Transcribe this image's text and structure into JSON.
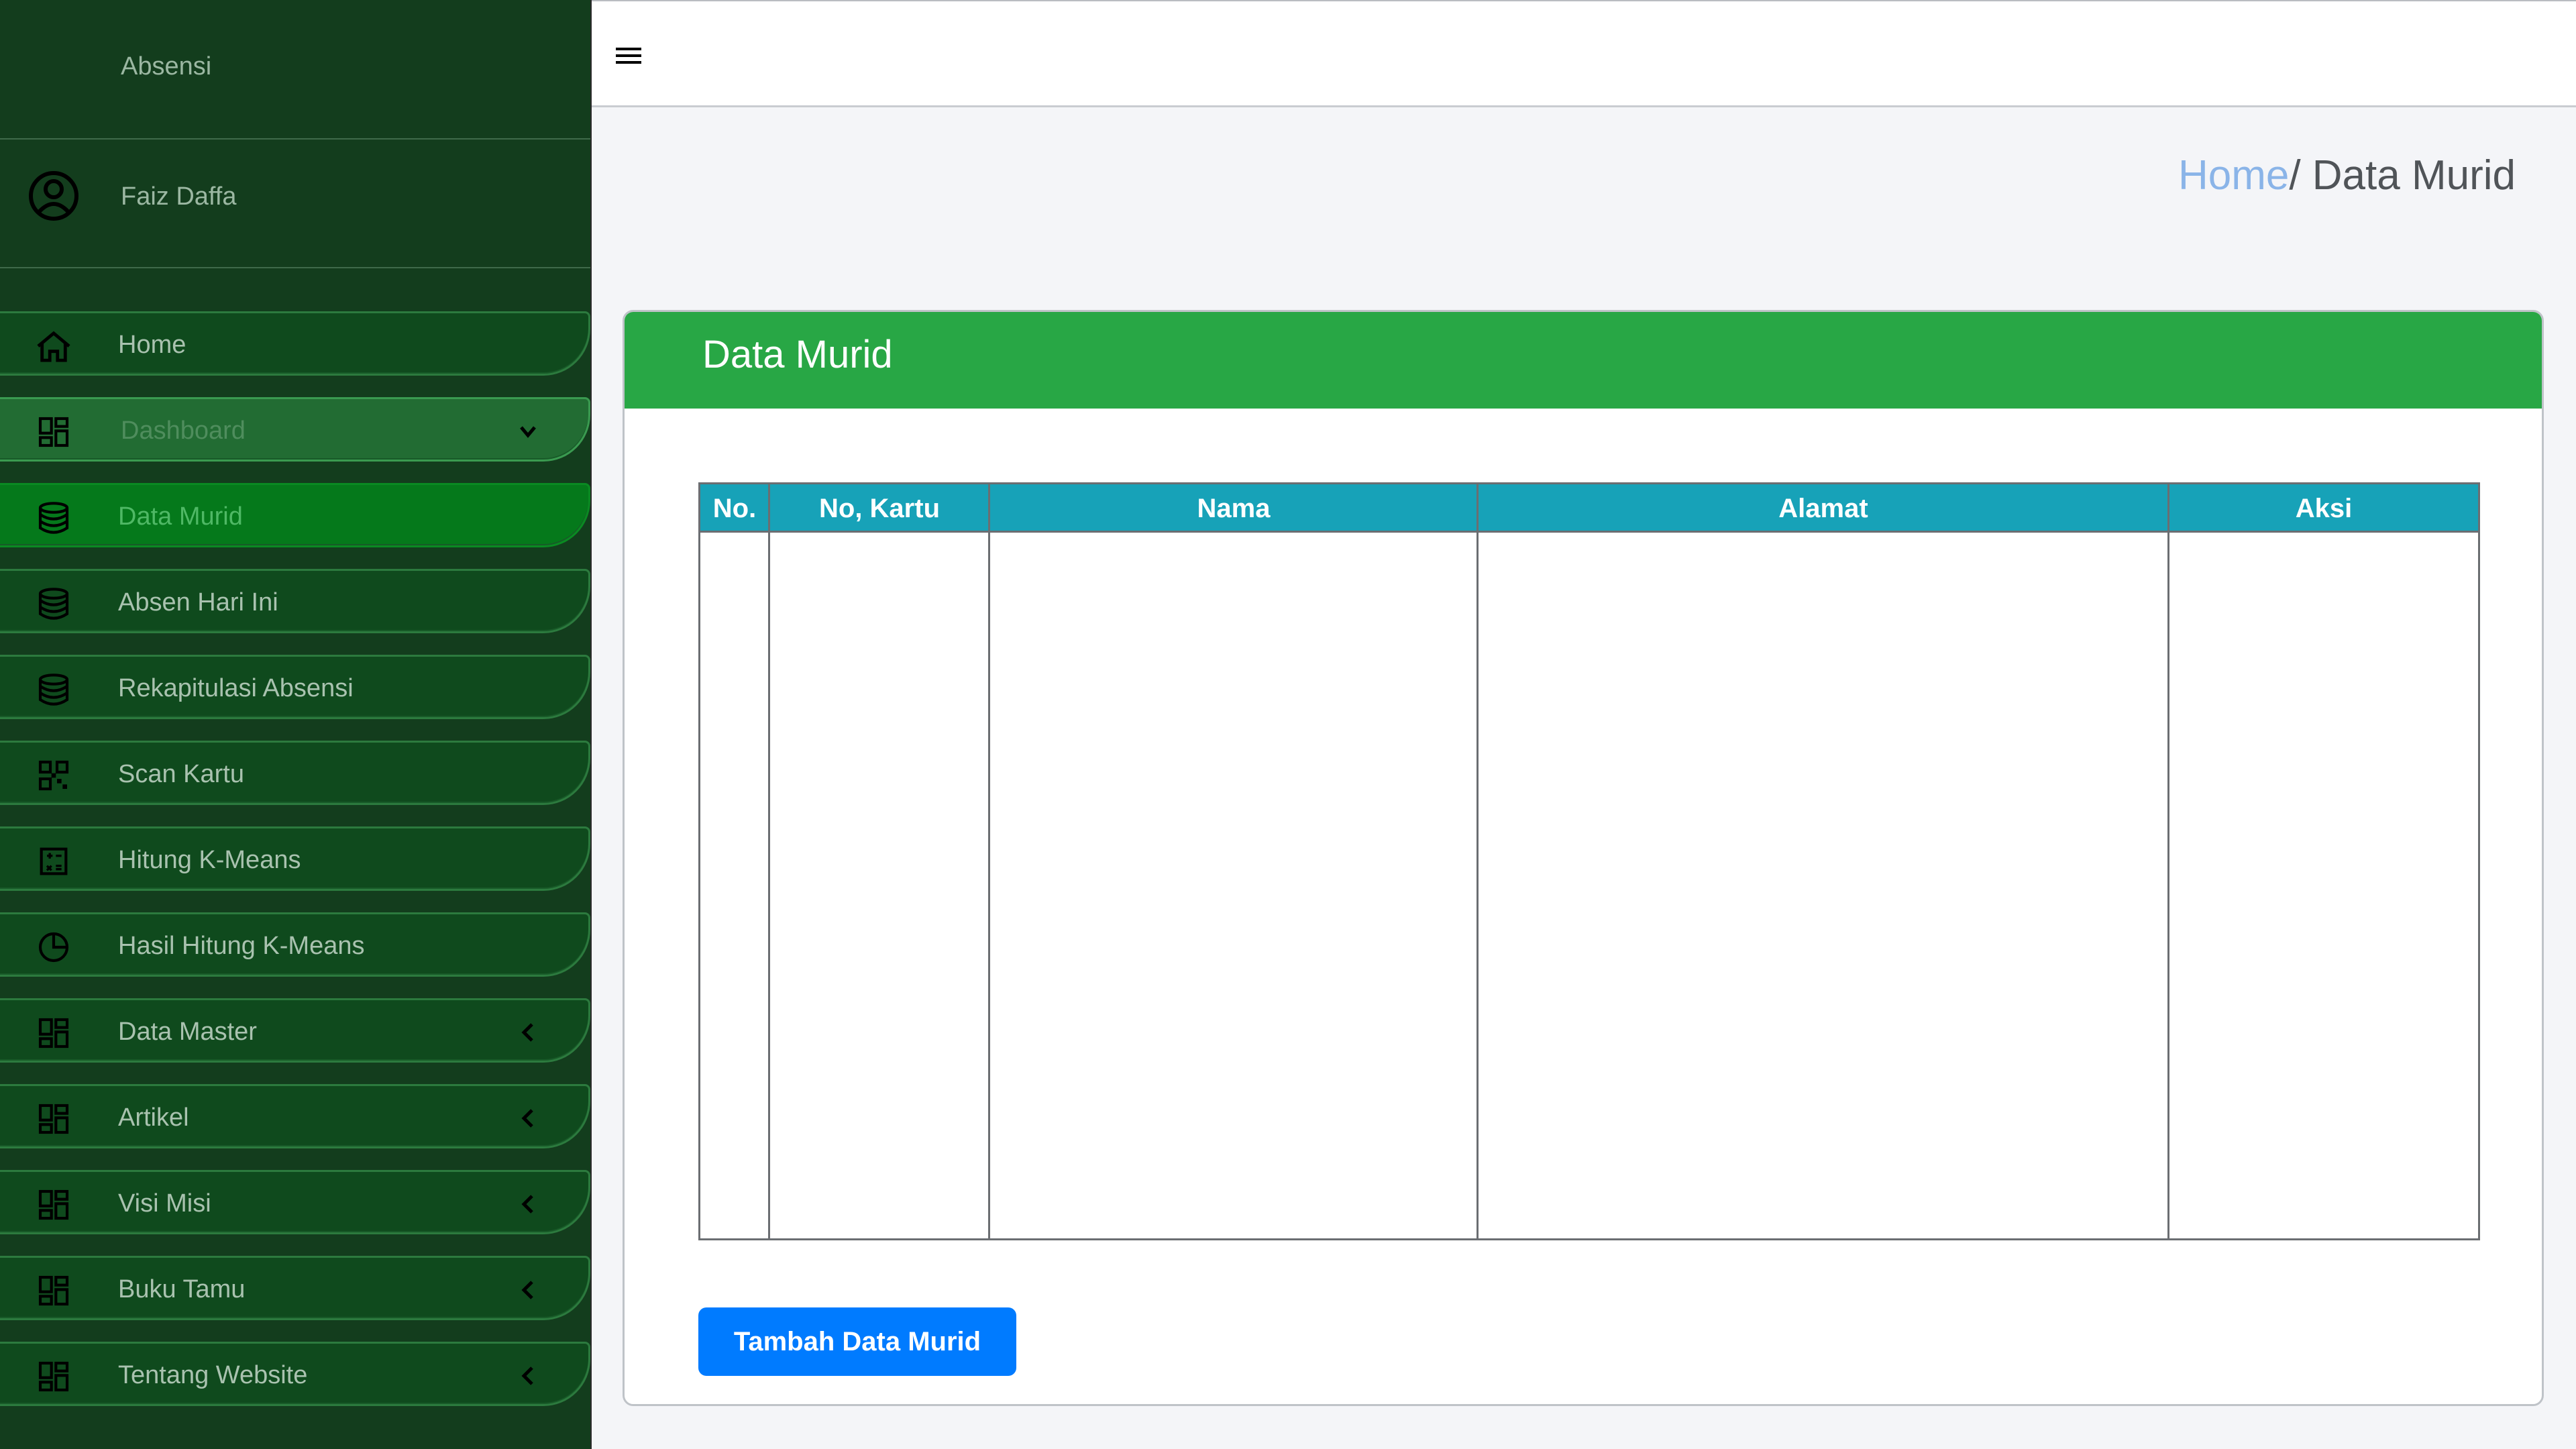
{
  "sidebar": {
    "brand": "Absensi",
    "user_name": "Faiz Daffa",
    "items": [
      {
        "label": "Home",
        "icon": "home-icon"
      },
      {
        "label": "Dashboard",
        "icon": "grid-icon"
      },
      {
        "label": "Data Murid",
        "icon": "database-icon"
      },
      {
        "label": "Absen Hari Ini",
        "icon": "database-icon"
      },
      {
        "label": "Rekapitulasi Absensi",
        "icon": "database-icon"
      },
      {
        "label": "Scan Kartu",
        "icon": "qr-code-icon"
      },
      {
        "label": "Hitung K-Means",
        "icon": "calculator-icon"
      },
      {
        "label": "Hasil Hitung K-Means",
        "icon": "pie-chart-icon"
      },
      {
        "label": "Data Master",
        "icon": "grid-icon"
      },
      {
        "label": "Artikel",
        "icon": "grid-icon"
      },
      {
        "label": "Visi Misi",
        "icon": "grid-icon"
      },
      {
        "label": "Buku Tamu",
        "icon": "grid-icon"
      },
      {
        "label": "Tentang Website",
        "icon": "grid-icon"
      }
    ]
  },
  "breadcrumb": {
    "home": "Home",
    "current": "/ Data Murid"
  },
  "card": {
    "title": "Data Murid"
  },
  "table": {
    "headers": [
      "No.",
      "No, Kartu",
      "Nama",
      "Alamat",
      "Aksi"
    ],
    "rows": []
  },
  "actions": {
    "add_label": "Tambah Data Murid"
  },
  "colors": {
    "sidebar_bg": "#133d1d",
    "active_item": "#05791b",
    "card_header": "#28a745",
    "table_header": "#17a2b8",
    "primary_button": "#007bff"
  }
}
